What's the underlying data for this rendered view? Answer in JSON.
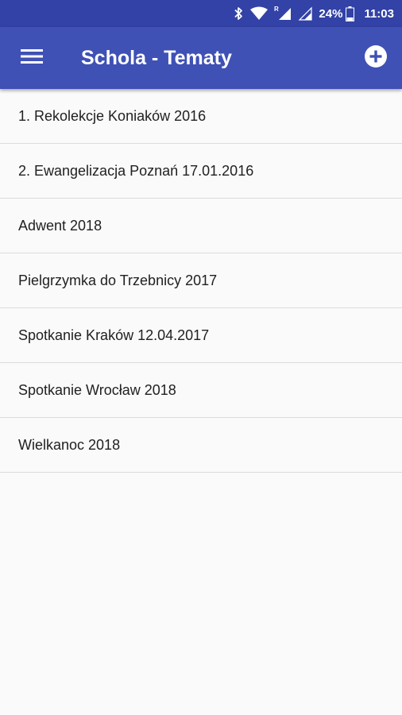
{
  "status_bar": {
    "battery": "24%",
    "time": "11:03",
    "icons": [
      "bluetooth-icon",
      "wifi-icon",
      "cell-signal-roaming-icon",
      "cell-signal-icon",
      "battery-icon"
    ]
  },
  "app_bar": {
    "title": "Schola - Tematy",
    "menu_icon": "hamburger-menu-icon",
    "add_icon": "add-circle-icon"
  },
  "colors": {
    "status_bar": "#3242a6",
    "app_bar": "#3f51b5",
    "background": "#fafafa",
    "divider": "#dcdcdc",
    "text": "#212121"
  },
  "topics": [
    {
      "label": "1. Rekolekcje Koniaków 2016"
    },
    {
      "label": "2. Ewangelizacja Poznań 17.01.2016"
    },
    {
      "label": "Adwent 2018"
    },
    {
      "label": "Pielgrzymka do Trzebnicy 2017"
    },
    {
      "label": "Spotkanie Kraków 12.04.2017"
    },
    {
      "label": "Spotkanie Wrocław 2018"
    },
    {
      "label": "Wielkanoc 2018"
    }
  ]
}
